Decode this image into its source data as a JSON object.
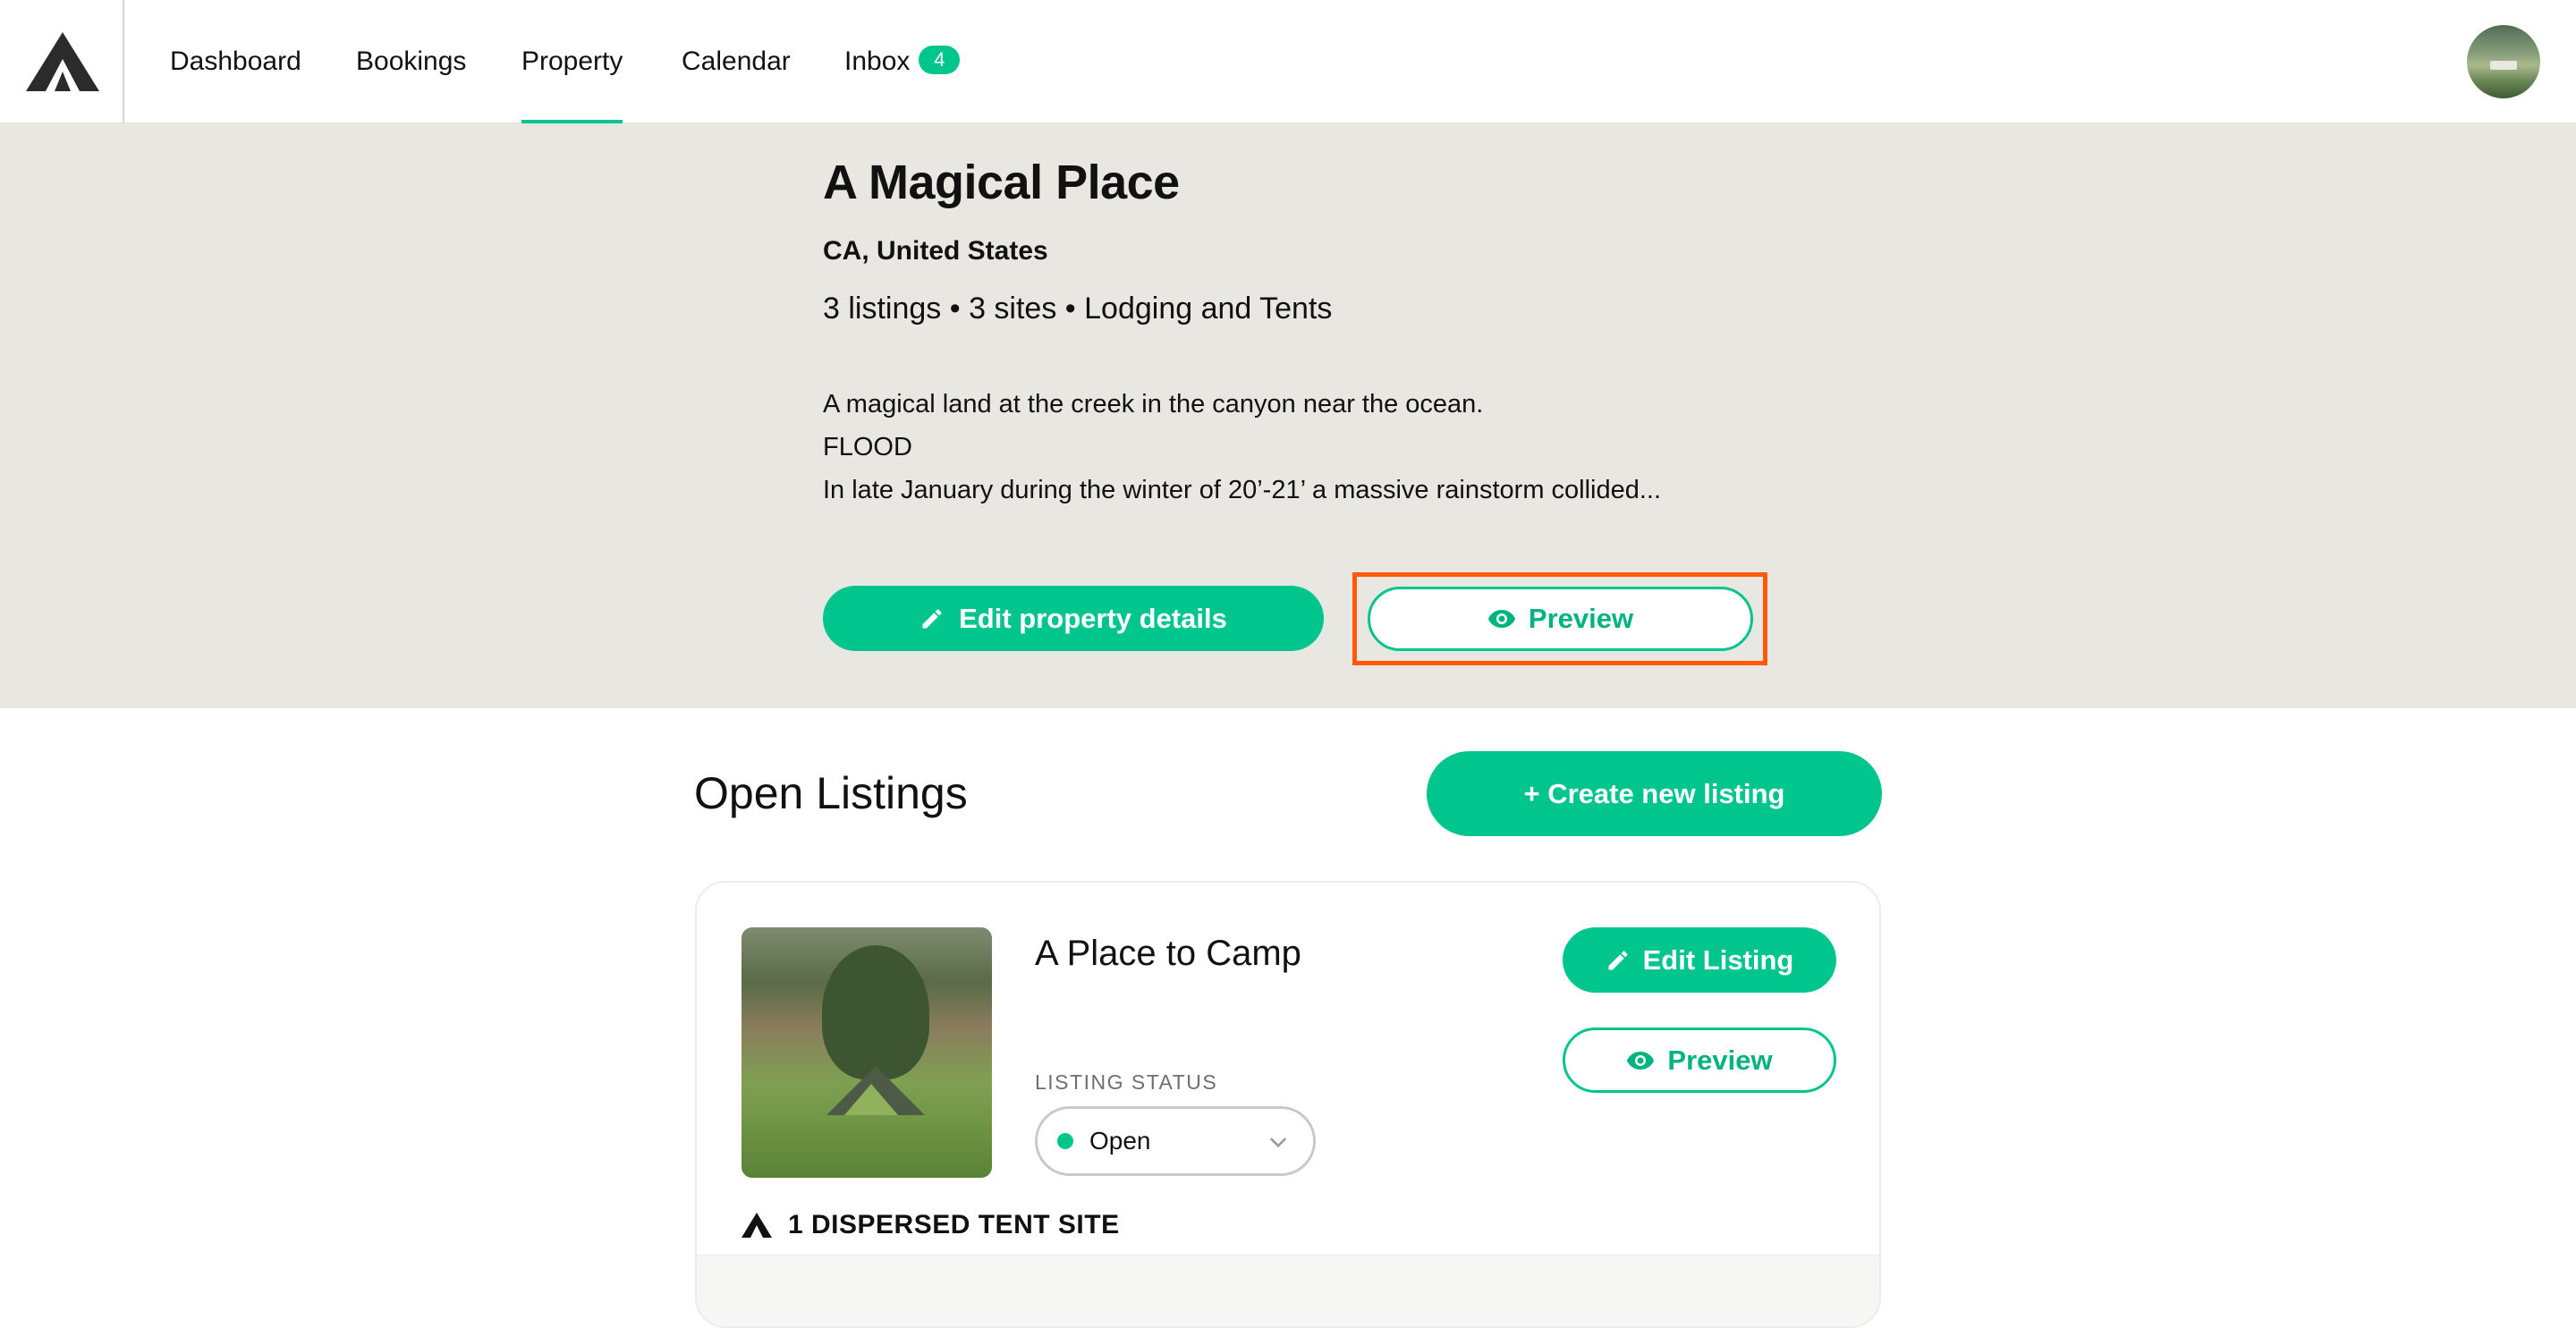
{
  "nav": {
    "items": [
      {
        "label": "Dashboard"
      },
      {
        "label": "Bookings"
      },
      {
        "label": "Property"
      },
      {
        "label": "Calendar"
      },
      {
        "label": "Inbox"
      }
    ],
    "active": "Property",
    "inbox_count": "4"
  },
  "property": {
    "title": "A Magical Place",
    "location": "CA, United States",
    "meta": "3 listings • 3 sites • Lodging and Tents",
    "description_lines": [
      "A magical land at the creek in the canyon near the ocean.",
      "FLOOD",
      "In late January during the winter of 20’-21’ a massive rainstorm collided..."
    ],
    "edit_label": "Edit property details",
    "preview_label": "Preview"
  },
  "listings": {
    "section_title": "Open Listings",
    "create_label": "+ Create new listing",
    "items": [
      {
        "name": "A Place to Camp",
        "status_label": "LISTING STATUS",
        "status_value": "Open",
        "edit_label": "Edit Listing",
        "preview_label": "Preview",
        "sites": "1 DISPERSED TENT SITE"
      }
    ]
  },
  "colors": {
    "accent": "#00c58c",
    "hero_bg": "#e8e7e2",
    "highlight": "#ff5a00"
  },
  "icons": [
    "logo-icon",
    "pencil-icon",
    "eye-icon",
    "chevron-down-icon",
    "tent-icon"
  ]
}
